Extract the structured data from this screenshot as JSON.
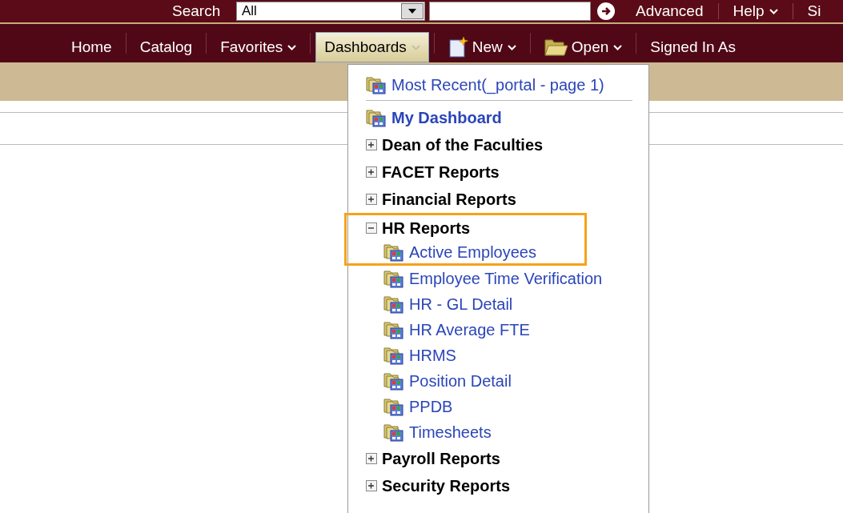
{
  "search_bar": {
    "label": "Search",
    "scope": "All",
    "advanced": "Advanced",
    "help": "Help",
    "signout": "Si"
  },
  "nav": [
    {
      "label": "Home",
      "kind": "link",
      "dropdown": false,
      "selected": false
    },
    {
      "label": "Catalog",
      "kind": "link",
      "dropdown": false,
      "selected": false
    },
    {
      "label": "Favorites",
      "kind": "link",
      "dropdown": true,
      "selected": false
    },
    {
      "label": "Dashboards",
      "kind": "link",
      "dropdown": true,
      "selected": true
    },
    {
      "label": "New",
      "kind": "new",
      "dropdown": true,
      "selected": false
    },
    {
      "label": "Open",
      "kind": "open",
      "dropdown": true,
      "selected": false
    },
    {
      "label": "Signed In As",
      "kind": "link",
      "dropdown": false,
      "selected": false
    }
  ],
  "dashboards_menu": [
    {
      "kind": "dashboard",
      "label": "Most Recent(_portal - page 1)",
      "bold": false,
      "highlighted": false
    },
    {
      "kind": "separator"
    },
    {
      "kind": "dashboard",
      "label": "My Dashboard",
      "bold": true,
      "highlighted": false
    },
    {
      "kind": "group",
      "label": "Dean of the Faculties",
      "expanded": false,
      "highlighted": false
    },
    {
      "kind": "group",
      "label": "FACET Reports",
      "expanded": false,
      "highlighted": false
    },
    {
      "kind": "group",
      "label": "Financial Reports",
      "expanded": false,
      "highlighted": false
    },
    {
      "kind": "group",
      "label": "HR Reports",
      "expanded": true,
      "highlighted": true,
      "children": [
        {
          "kind": "dashboard",
          "label": "Active Employees",
          "bold": false,
          "highlighted": true
        },
        {
          "kind": "dashboard",
          "label": "Employee Time Verification",
          "bold": false,
          "highlighted": false
        },
        {
          "kind": "dashboard",
          "label": "HR - GL Detail",
          "bold": false,
          "highlighted": false
        },
        {
          "kind": "dashboard",
          "label": "HR Average FTE",
          "bold": false,
          "highlighted": false
        },
        {
          "kind": "dashboard",
          "label": "HRMS",
          "bold": false,
          "highlighted": false
        },
        {
          "kind": "dashboard",
          "label": "Position Detail",
          "bold": false,
          "highlighted": false
        },
        {
          "kind": "dashboard",
          "label": "PPDB",
          "bold": false,
          "highlighted": false
        },
        {
          "kind": "dashboard",
          "label": "Timesheets",
          "bold": false,
          "highlighted": false
        }
      ]
    },
    {
      "kind": "group",
      "label": "Payroll Reports",
      "expanded": false,
      "highlighted": false
    },
    {
      "kind": "group",
      "label": "Security Reports",
      "expanded": false,
      "highlighted": false
    }
  ]
}
